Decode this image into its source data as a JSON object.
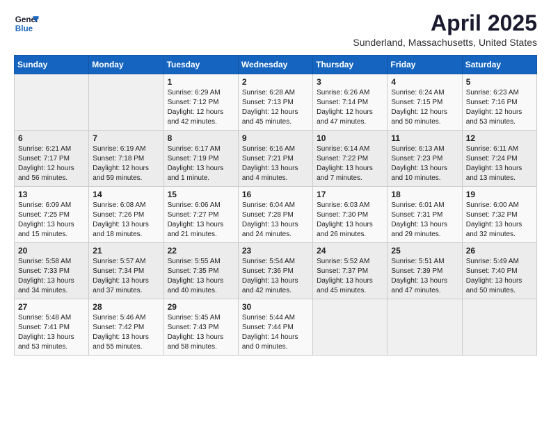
{
  "header": {
    "logo_line1": "General",
    "logo_line2": "Blue",
    "month": "April 2025",
    "location": "Sunderland, Massachusetts, United States"
  },
  "weekdays": [
    "Sunday",
    "Monday",
    "Tuesday",
    "Wednesday",
    "Thursday",
    "Friday",
    "Saturday"
  ],
  "weeks": [
    [
      {
        "day": "",
        "info": ""
      },
      {
        "day": "",
        "info": ""
      },
      {
        "day": "1",
        "info": "Sunrise: 6:29 AM\nSunset: 7:12 PM\nDaylight: 12 hours\nand 42 minutes."
      },
      {
        "day": "2",
        "info": "Sunrise: 6:28 AM\nSunset: 7:13 PM\nDaylight: 12 hours\nand 45 minutes."
      },
      {
        "day": "3",
        "info": "Sunrise: 6:26 AM\nSunset: 7:14 PM\nDaylight: 12 hours\nand 47 minutes."
      },
      {
        "day": "4",
        "info": "Sunrise: 6:24 AM\nSunset: 7:15 PM\nDaylight: 12 hours\nand 50 minutes."
      },
      {
        "day": "5",
        "info": "Sunrise: 6:23 AM\nSunset: 7:16 PM\nDaylight: 12 hours\nand 53 minutes."
      }
    ],
    [
      {
        "day": "6",
        "info": "Sunrise: 6:21 AM\nSunset: 7:17 PM\nDaylight: 12 hours\nand 56 minutes."
      },
      {
        "day": "7",
        "info": "Sunrise: 6:19 AM\nSunset: 7:18 PM\nDaylight: 12 hours\nand 59 minutes."
      },
      {
        "day": "8",
        "info": "Sunrise: 6:17 AM\nSunset: 7:19 PM\nDaylight: 13 hours\nand 1 minute."
      },
      {
        "day": "9",
        "info": "Sunrise: 6:16 AM\nSunset: 7:21 PM\nDaylight: 13 hours\nand 4 minutes."
      },
      {
        "day": "10",
        "info": "Sunrise: 6:14 AM\nSunset: 7:22 PM\nDaylight: 13 hours\nand 7 minutes."
      },
      {
        "day": "11",
        "info": "Sunrise: 6:13 AM\nSunset: 7:23 PM\nDaylight: 13 hours\nand 10 minutes."
      },
      {
        "day": "12",
        "info": "Sunrise: 6:11 AM\nSunset: 7:24 PM\nDaylight: 13 hours\nand 13 minutes."
      }
    ],
    [
      {
        "day": "13",
        "info": "Sunrise: 6:09 AM\nSunset: 7:25 PM\nDaylight: 13 hours\nand 15 minutes."
      },
      {
        "day": "14",
        "info": "Sunrise: 6:08 AM\nSunset: 7:26 PM\nDaylight: 13 hours\nand 18 minutes."
      },
      {
        "day": "15",
        "info": "Sunrise: 6:06 AM\nSunset: 7:27 PM\nDaylight: 13 hours\nand 21 minutes."
      },
      {
        "day": "16",
        "info": "Sunrise: 6:04 AM\nSunset: 7:28 PM\nDaylight: 13 hours\nand 24 minutes."
      },
      {
        "day": "17",
        "info": "Sunrise: 6:03 AM\nSunset: 7:30 PM\nDaylight: 13 hours\nand 26 minutes."
      },
      {
        "day": "18",
        "info": "Sunrise: 6:01 AM\nSunset: 7:31 PM\nDaylight: 13 hours\nand 29 minutes."
      },
      {
        "day": "19",
        "info": "Sunrise: 6:00 AM\nSunset: 7:32 PM\nDaylight: 13 hours\nand 32 minutes."
      }
    ],
    [
      {
        "day": "20",
        "info": "Sunrise: 5:58 AM\nSunset: 7:33 PM\nDaylight: 13 hours\nand 34 minutes."
      },
      {
        "day": "21",
        "info": "Sunrise: 5:57 AM\nSunset: 7:34 PM\nDaylight: 13 hours\nand 37 minutes."
      },
      {
        "day": "22",
        "info": "Sunrise: 5:55 AM\nSunset: 7:35 PM\nDaylight: 13 hours\nand 40 minutes."
      },
      {
        "day": "23",
        "info": "Sunrise: 5:54 AM\nSunset: 7:36 PM\nDaylight: 13 hours\nand 42 minutes."
      },
      {
        "day": "24",
        "info": "Sunrise: 5:52 AM\nSunset: 7:37 PM\nDaylight: 13 hours\nand 45 minutes."
      },
      {
        "day": "25",
        "info": "Sunrise: 5:51 AM\nSunset: 7:39 PM\nDaylight: 13 hours\nand 47 minutes."
      },
      {
        "day": "26",
        "info": "Sunrise: 5:49 AM\nSunset: 7:40 PM\nDaylight: 13 hours\nand 50 minutes."
      }
    ],
    [
      {
        "day": "27",
        "info": "Sunrise: 5:48 AM\nSunset: 7:41 PM\nDaylight: 13 hours\nand 53 minutes."
      },
      {
        "day": "28",
        "info": "Sunrise: 5:46 AM\nSunset: 7:42 PM\nDaylight: 13 hours\nand 55 minutes."
      },
      {
        "day": "29",
        "info": "Sunrise: 5:45 AM\nSunset: 7:43 PM\nDaylight: 13 hours\nand 58 minutes."
      },
      {
        "day": "30",
        "info": "Sunrise: 5:44 AM\nSunset: 7:44 PM\nDaylight: 14 hours\nand 0 minutes."
      },
      {
        "day": "",
        "info": ""
      },
      {
        "day": "",
        "info": ""
      },
      {
        "day": "",
        "info": ""
      }
    ]
  ]
}
